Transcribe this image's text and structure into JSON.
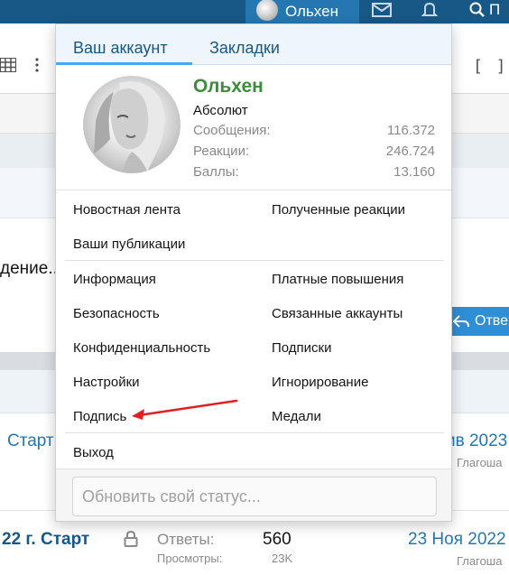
{
  "colors": {
    "topbar": "#185886",
    "topbar_active": "#2577b1",
    "link": "#2577b1",
    "username": "#3b8e3b",
    "tab_underline": "#47a7eb",
    "annotation_arrow": "#e02020"
  },
  "topbar": {
    "username": "Ольхен",
    "avatar_icon": "user-avatar",
    "mail_icon": "envelope-icon",
    "bell_icon": "bell-icon",
    "search_icon": "search-icon",
    "search_label": "П"
  },
  "background": {
    "partial_text": "дение...",
    "reply_button": "Отве",
    "row1": {
      "title": "Старт",
      "date": "ив 2023",
      "last_user": "Глагоша"
    },
    "row2": {
      "title": "22 г. Старт",
      "replies_label": "Ответы:",
      "replies_value": "560",
      "views_label": "Просмотры:",
      "views_value": "23K",
      "date": "23 Ноя 2022",
      "last_user": "Глагоша"
    }
  },
  "popup": {
    "tabs": [
      "Ваш аккаунт",
      "Закладки"
    ],
    "profile": {
      "name": "Ольхен",
      "title": "Абсолют",
      "stats": [
        {
          "label": "Сообщения:",
          "value": "116.372"
        },
        {
          "label": "Реакции:",
          "value": "246.724"
        },
        {
          "label": "Баллы:",
          "value": "13.160"
        }
      ]
    },
    "menu": {
      "news_feed": "Новостная лента",
      "received_reactions": "Полученные реакции",
      "your_content": "Ваши публикации",
      "info": "Информация",
      "paid_upgrades": "Платные повышения",
      "security": "Безопасность",
      "connected_accounts": "Связанные аккаунты",
      "privacy": "Конфиденциальность",
      "subscriptions": "Подписки",
      "preferences": "Настройки",
      "ignoring": "Игнорирование",
      "signature": "Подпись",
      "trophies": "Медали",
      "logout": "Выход"
    },
    "status_placeholder": "Обновить свой статус..."
  }
}
